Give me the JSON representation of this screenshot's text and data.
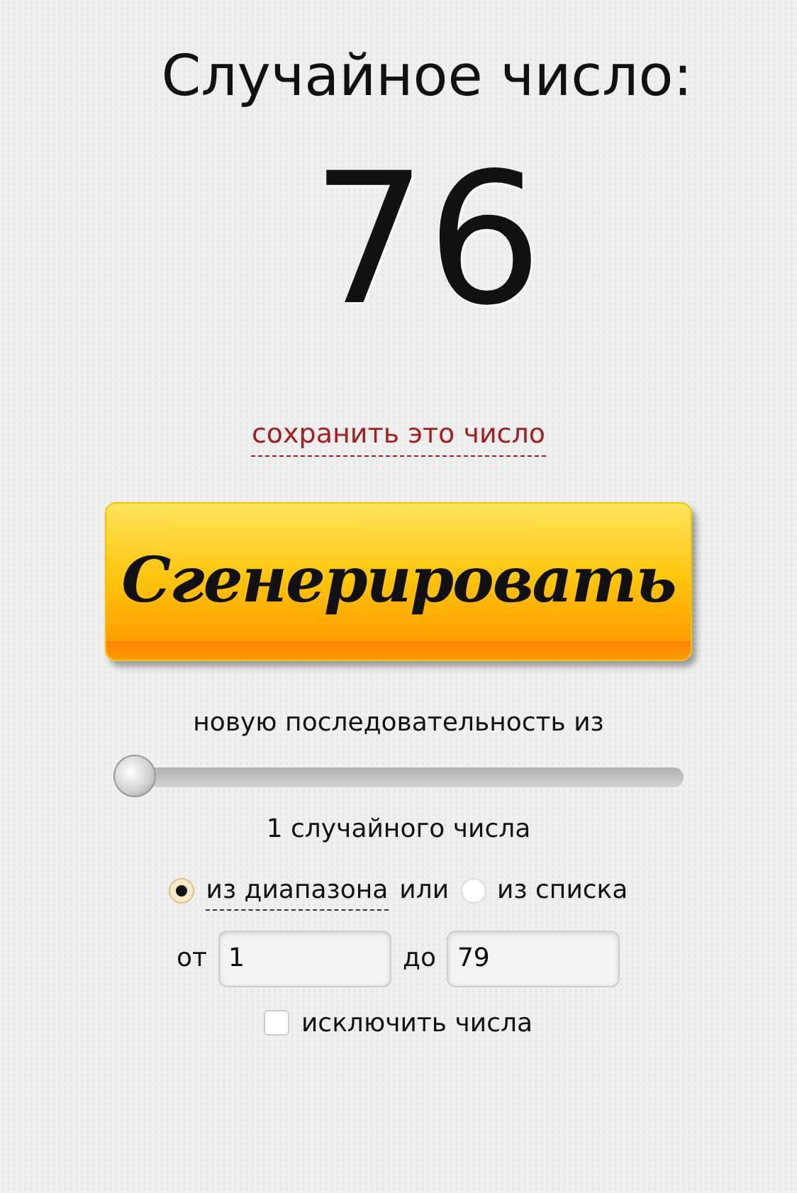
{
  "title": "Случайное число:",
  "number": "76",
  "save_link": "сохранить это число",
  "generate_button": "Сгенерировать",
  "sequence_label": "новую последовательность из",
  "count_slider": {
    "level": 0
  },
  "count_label": "1 случайного числа",
  "source_options": [
    {
      "label": "из диапазона",
      "selected": true
    },
    {
      "label": "из списка",
      "selected": false
    }
  ],
  "options_connector": "или",
  "range": {
    "from_label": "от",
    "from_value": "1",
    "to_label": "до",
    "to_value": "79"
  },
  "exclude": {
    "label": "исключить числа",
    "checked": false
  }
}
